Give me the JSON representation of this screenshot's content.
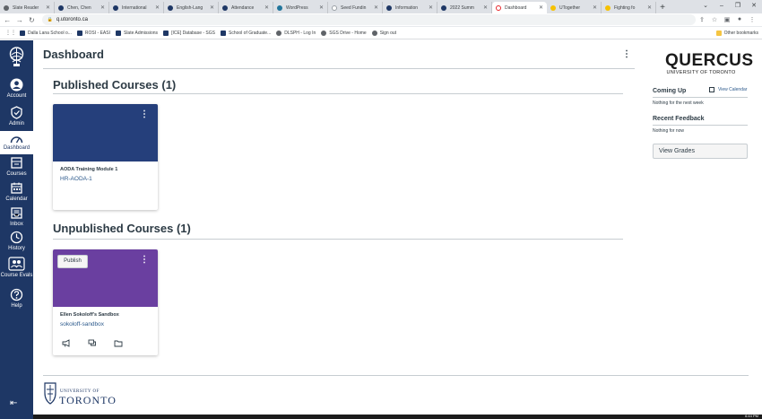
{
  "browser": {
    "tabs": [
      {
        "title": "Slate Reader",
        "favicon": "gray-icon",
        "active": false
      },
      {
        "title": "Chen, Chen",
        "favicon": "uoft-icon",
        "active": false
      },
      {
        "title": "International",
        "favicon": "uoft-icon",
        "active": false
      },
      {
        "title": "English-Lang",
        "favicon": "uoft-icon",
        "active": false
      },
      {
        "title": "Attendance",
        "favicon": "uoft-icon",
        "active": false
      },
      {
        "title": "WordPress",
        "favicon": "wordpress-icon",
        "active": false
      },
      {
        "title": "Seed Fundin",
        "favicon": "seed-icon",
        "active": false
      },
      {
        "title": "Information",
        "favicon": "uoft-icon",
        "active": false
      },
      {
        "title": "2022 Summ",
        "favicon": "uoft-icon",
        "active": false
      },
      {
        "title": "Dashboard",
        "favicon": "canvas-icon",
        "active": true
      },
      {
        "title": "UTogether",
        "favicon": "yellow-icon",
        "active": false
      },
      {
        "title": "Fighting fo",
        "favicon": "yellow-icon",
        "active": false
      }
    ],
    "new_tab": "+",
    "url": "q.utoronto.ca",
    "bookmarks": [
      {
        "label": "Dalla Lana School o...",
        "icon": "shield-icon"
      },
      {
        "label": "ROSI - EASI",
        "icon": "shield-icon"
      },
      {
        "label": "Slate Admissions",
        "icon": "shield-icon"
      },
      {
        "label": "[ICE] Database - SGS",
        "icon": "shield-icon"
      },
      {
        "label": "School of Graduate...",
        "icon": "shield-icon"
      },
      {
        "label": "DLSPH - Log In",
        "icon": "globe-icon"
      },
      {
        "label": "SGS Drive - Home",
        "icon": "globe-icon"
      },
      {
        "label": "Sign out",
        "icon": "globe-icon"
      }
    ],
    "other_bookmarks": "Other bookmarks"
  },
  "global_nav": {
    "items": [
      {
        "label": "Account",
        "icon": "account-icon"
      },
      {
        "label": "Admin",
        "icon": "admin-icon"
      },
      {
        "label": "Dashboard",
        "icon": "dashboard-icon",
        "active": true
      },
      {
        "label": "Courses",
        "icon": "courses-icon"
      },
      {
        "label": "Calendar",
        "icon": "calendar-icon"
      },
      {
        "label": "Inbox",
        "icon": "inbox-icon"
      },
      {
        "label": "History",
        "icon": "history-icon"
      },
      {
        "label": "Course Evals",
        "icon": "course-evals-icon"
      },
      {
        "label": "Help",
        "icon": "help-icon"
      }
    ],
    "colors": {
      "nav_bg": "#1e3765",
      "published_card": "#253f7b",
      "unpublished_card": "#6a3fa0"
    }
  },
  "main": {
    "title": "Dashboard",
    "published": {
      "heading": "Published Courses (1)",
      "courses": [
        {
          "name": "AODA Training Module 1",
          "code": "HR-AODA-1",
          "color": "#253f7b"
        }
      ]
    },
    "unpublished": {
      "heading": "Unpublished Courses (1)",
      "courses": [
        {
          "name": "Ellen Sokoloff's Sandbox",
          "code": "sokoloff-sandbox",
          "color": "#6a3fa0",
          "publish_label": "Publish"
        }
      ]
    },
    "footer": {
      "university": "UNIVERSITY OF",
      "toronto": "TORONTO"
    }
  },
  "sidebar": {
    "brand": {
      "name": "QUERCUS",
      "sub": "UNIVERSITY OF TORONTO"
    },
    "coming_up": {
      "heading": "Coming Up",
      "view_calendar": "View Calendar",
      "empty": "Nothing for the next week"
    },
    "recent_feedback": {
      "heading": "Recent Feedback",
      "empty": "Nothing for now"
    },
    "view_grades": "View Grades"
  },
  "taskbar": {
    "clock": "6:44 PM"
  }
}
